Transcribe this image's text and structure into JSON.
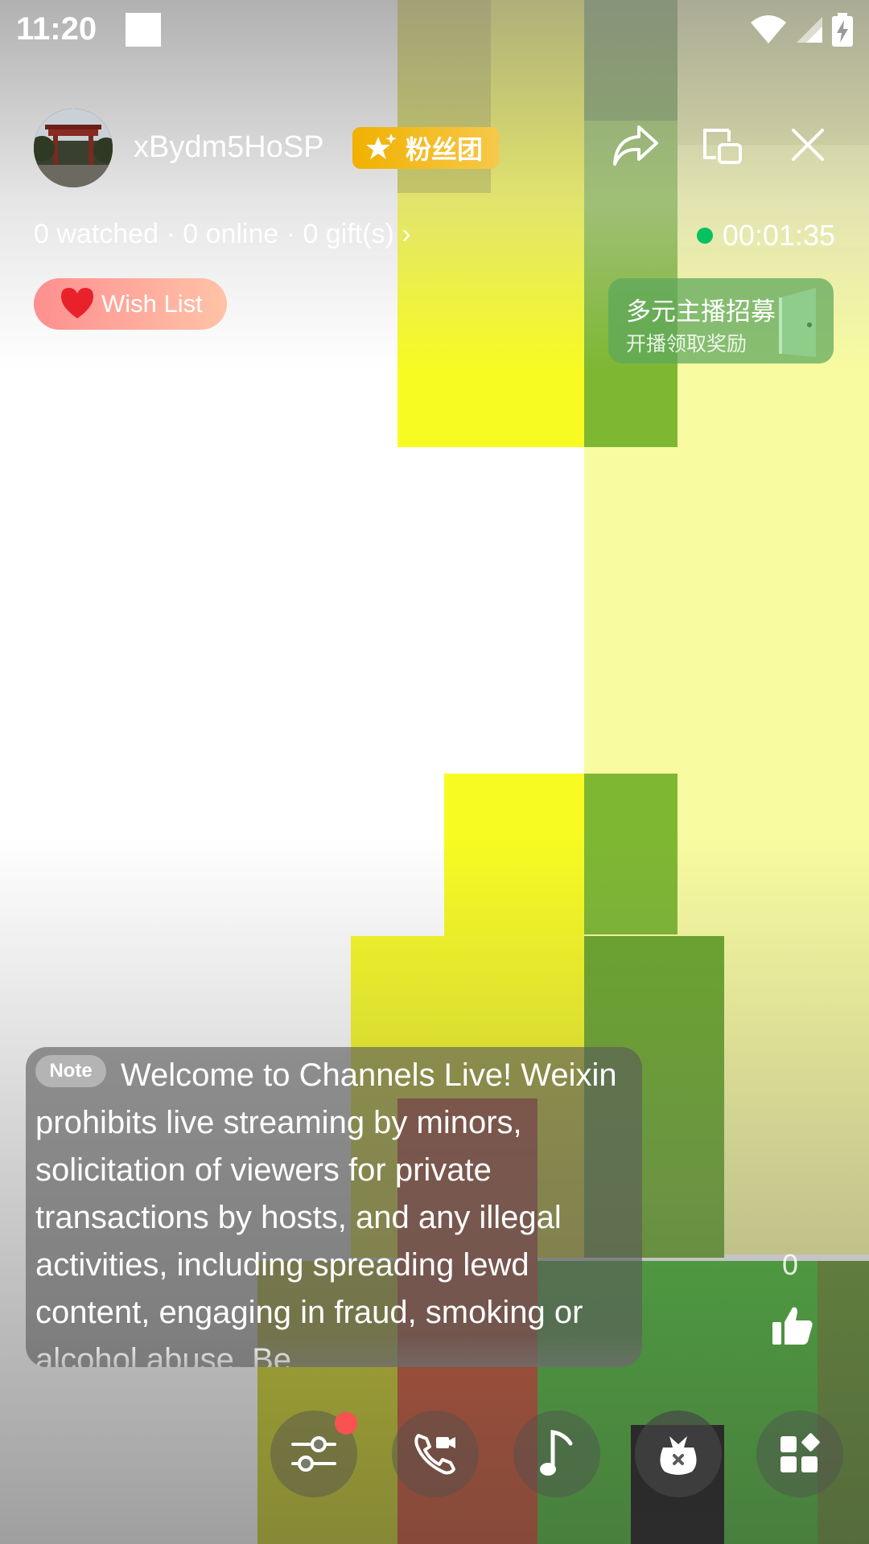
{
  "status_bar": {
    "time": "11:20",
    "icons": [
      "wifi-icon",
      "signal-icon",
      "battery-charging-icon"
    ]
  },
  "host": {
    "name": "xBydm5HoSP",
    "fan_club_label": "粉丝团"
  },
  "header_actions": [
    "share-icon",
    "float-window-icon",
    "close-icon"
  ],
  "stats": {
    "text": "0 watched · 0 online · 0 gift(s) ›"
  },
  "live_timer": "00:01:35",
  "wish_list": {
    "label": "Wish List"
  },
  "recruit_banner": {
    "title": "多元主播招募",
    "subtitle": "开播领取奖励"
  },
  "note": {
    "badge": "Note",
    "text": "Welcome to Channels Live! Weixin prohibits live streaming by minors, solicitation of viewers for private transactions by hosts, and any illegal activities, including spreading lewd content, engaging in fraud, smoking or alcohol abuse. Be"
  },
  "likes": {
    "count": "0"
  },
  "toolbar": [
    "settings-sliders-icon",
    "video-call-icon",
    "music-note-icon",
    "gift-bag-icon",
    "more-apps-icon"
  ],
  "colors": {
    "accent_green": "#07c160",
    "fan_gold": "#f1b100",
    "wish_pink": "#ff8f8f",
    "notify_red": "#fa5151"
  }
}
